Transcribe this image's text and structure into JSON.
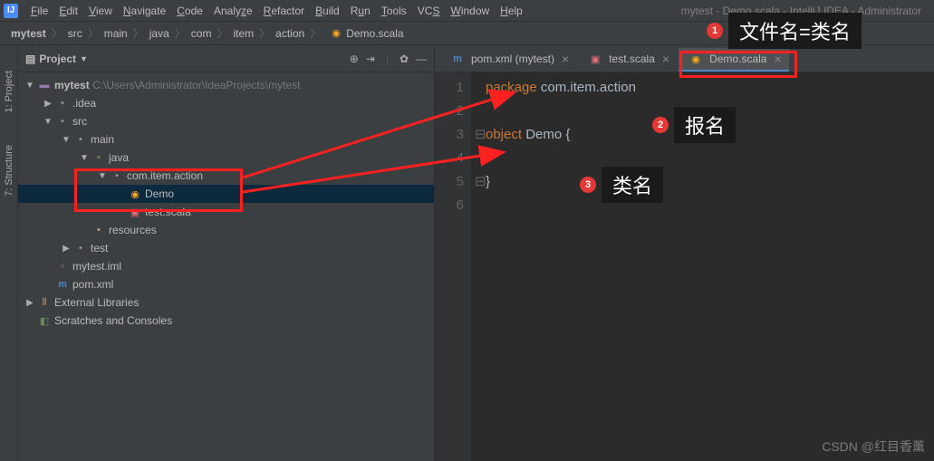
{
  "app": {
    "icon_letter": "IJ",
    "title": "mytest - Demo.scala - IntelliJ IDEA - Administrator"
  },
  "menu": [
    "File",
    "Edit",
    "View",
    "Navigate",
    "Code",
    "Analyze",
    "Refactor",
    "Build",
    "Run",
    "Tools",
    "VCS",
    "Window",
    "Help"
  ],
  "breadcrumb": {
    "items": [
      "mytest",
      "src",
      "main",
      "java",
      "com",
      "item",
      "action"
    ],
    "file": "Demo.scala"
  },
  "gutter": {
    "project": "1: Project",
    "structure": "7: Structure"
  },
  "panel": {
    "title": "Project",
    "tree": {
      "root": "mytest",
      "root_hint": "C:\\Users\\Administrator\\IdeaProjects\\mytest",
      "idea": ".idea",
      "src": "src",
      "main": "main",
      "java": "java",
      "pkg": "com.item.action",
      "demo": "Demo",
      "testscala": "test.scala",
      "resources": "resources",
      "test": "test",
      "iml": "mytest.iml",
      "pom": "pom.xml",
      "ext": "External Libraries",
      "scratches": "Scratches and Consoles"
    }
  },
  "tabs": [
    {
      "label": "pom.xml (mytest)",
      "icon": "m"
    },
    {
      "label": "test.scala",
      "icon": "s"
    },
    {
      "label": "Demo.scala",
      "icon": "o",
      "active": true
    }
  ],
  "code": {
    "lines": [
      "1",
      "2",
      "3",
      "4",
      "5",
      "6"
    ],
    "l1_kw": "package",
    "l1_rest": " com.item.action",
    "l3_kw": "object",
    "l3_rest": " Demo {",
    "l5": "}"
  },
  "annotations": {
    "a1": {
      "num": "1",
      "text": "文件名=类名"
    },
    "a2": {
      "num": "2",
      "text": "报名"
    },
    "a3": {
      "num": "3",
      "text": "类名"
    }
  },
  "watermark": "CSDN @红目香薰"
}
